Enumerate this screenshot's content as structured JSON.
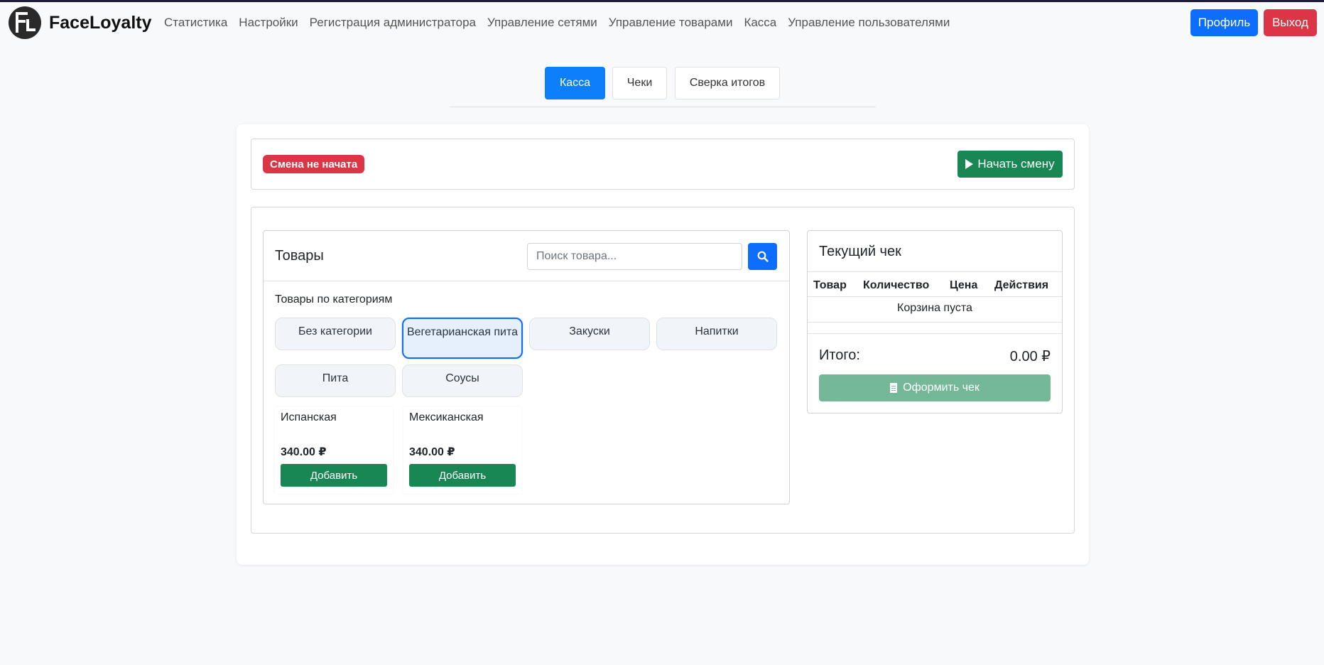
{
  "app": {
    "brand": "FaceLoyalty"
  },
  "nav": {
    "links": [
      "Статистика",
      "Настройки",
      "Регистрация администратора",
      "Управление сетями",
      "Управление товарами",
      "Касса",
      "Управление пользователями"
    ],
    "profile_label": "Профиль",
    "logout_label": "Выход"
  },
  "tabs": [
    {
      "label": "Касса",
      "active": true
    },
    {
      "label": "Чеки",
      "active": false
    },
    {
      "label": "Сверка итогов",
      "active": false
    }
  ],
  "shift": {
    "status_label": "Смена не начата",
    "start_label": "Начать смену"
  },
  "products": {
    "title": "Товары",
    "search_placeholder": "Поиск товара...",
    "categories_heading": "Товары по категориям",
    "categories": [
      {
        "label": "Без категории",
        "active": false
      },
      {
        "label": "Вегетарианская пита",
        "active": true
      },
      {
        "label": "Закуски",
        "active": false
      },
      {
        "label": "Напитки",
        "active": false
      },
      {
        "label": "Пита",
        "active": false
      },
      {
        "label": "Соусы",
        "active": false
      }
    ],
    "items": [
      {
        "name": "Испанская",
        "price": "340.00 ₽",
        "add_label": "Добавить"
      },
      {
        "name": "Мексиканская",
        "price": "340.00 ₽",
        "add_label": "Добавить"
      }
    ]
  },
  "receipt": {
    "title": "Текущий чек",
    "columns": [
      "Товар",
      "Количество",
      "Цена",
      "Действия"
    ],
    "empty_text": "Корзина пуста",
    "total_label": "Итого:",
    "total_value": "0.00 ₽",
    "checkout_label": "Оформить чек"
  },
  "colors": {
    "primary": "#0d6efd",
    "danger": "#dc3545",
    "success": "#198754",
    "success_disabled": "#74b898"
  }
}
